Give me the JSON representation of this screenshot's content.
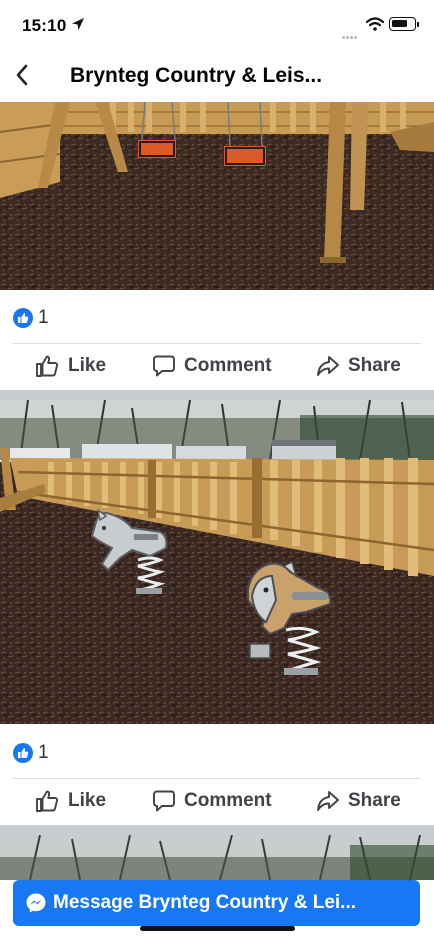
{
  "status_bar": {
    "time": "15:10"
  },
  "header": {
    "title": "Brynteg Country & Leis..."
  },
  "posts": [
    {
      "reaction_count": "1",
      "like_label": "Like",
      "comment_label": "Comment",
      "share_label": "Share"
    },
    {
      "reaction_count": "1",
      "like_label": "Like",
      "comment_label": "Comment",
      "share_label": "Share"
    }
  ],
  "footer": {
    "message_button_label": "Message Brynteg Country & Lei..."
  },
  "colors": {
    "brand_blue": "#1877f2",
    "text_gray": "#404448",
    "separator": "#c9ccd1"
  },
  "icons": [
    "location-arrow-icon",
    "wifi-icon",
    "battery-icon",
    "back-chevron-icon",
    "like-reaction-icon",
    "thumbs-up-icon",
    "comment-bubble-icon",
    "share-arrow-icon",
    "messenger-icon"
  ]
}
